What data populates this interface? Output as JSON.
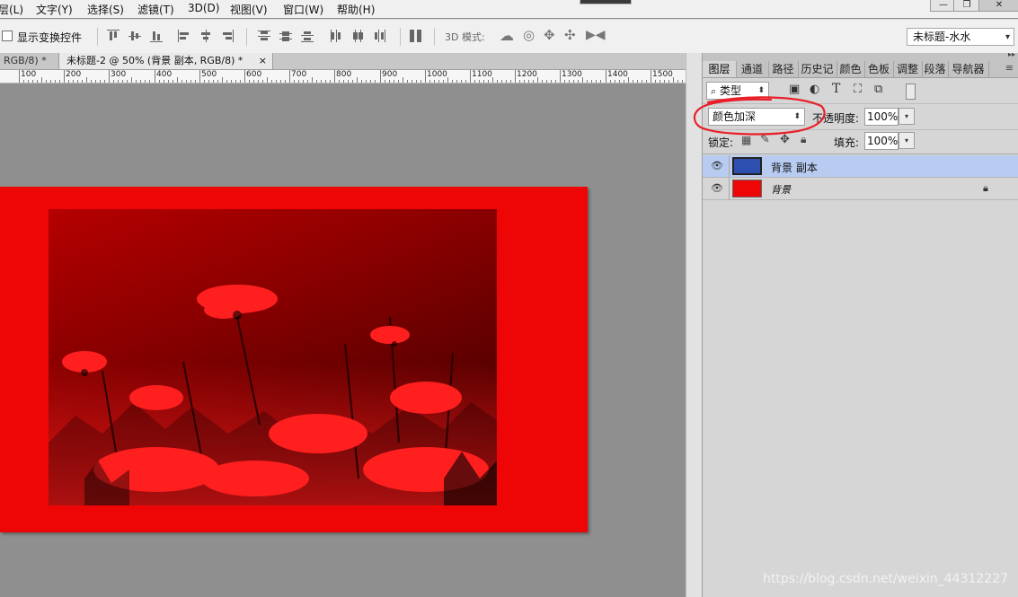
{
  "menubar": {
    "items": [
      "层(L)",
      "文字(Y)",
      "选择(S)",
      "滤镜(T)",
      "3D(D)",
      "视图(V)",
      "窗口(W)",
      "帮助(H)"
    ]
  },
  "window_controls": {
    "minimize": "—",
    "restore": "❐",
    "close": "✕"
  },
  "options_bar": {
    "show_transform_label": "显示变换控件",
    "show_transform_checked": false,
    "mode_3d_label": "3D 模式:",
    "preset_value": "未标题-水水"
  },
  "tabs": [
    {
      "label": "RGB/8) *",
      "active": false
    },
    {
      "label": "未标题-2 @ 50% (背景 副本, RGB/8) *",
      "active": true
    }
  ],
  "tab_close_glyph": "×",
  "ruler": {
    "labels": [
      "100",
      "200",
      "300",
      "400",
      "500",
      "600",
      "700",
      "800",
      "900",
      "1000",
      "1100",
      "1200",
      "1300",
      "1400",
      "1500"
    ]
  },
  "layers_panel": {
    "tabs": [
      "图层",
      "通道",
      "路径",
      "历史记",
      "颜色",
      "色板",
      "调整",
      "段落",
      "导航器"
    ],
    "active_tab": "图层",
    "filter_label": "类型",
    "blend_mode": "颜色加深",
    "opacity_label": "不透明度:",
    "opacity_value": "100%",
    "lock_label": "锁定:",
    "fill_label": "填充:",
    "fill_value": "100%",
    "layers": [
      {
        "name": "背景 副本",
        "selected": true,
        "locked": false
      },
      {
        "name": "背景",
        "selected": false,
        "locked": true
      }
    ]
  },
  "document": {
    "background_color": "#ee0505"
  },
  "watermark": "https://blog.csdn.net/weixin_44312227",
  "colors": {
    "accent_selection": "#b8ccf2",
    "annotation": "#e8202a"
  }
}
